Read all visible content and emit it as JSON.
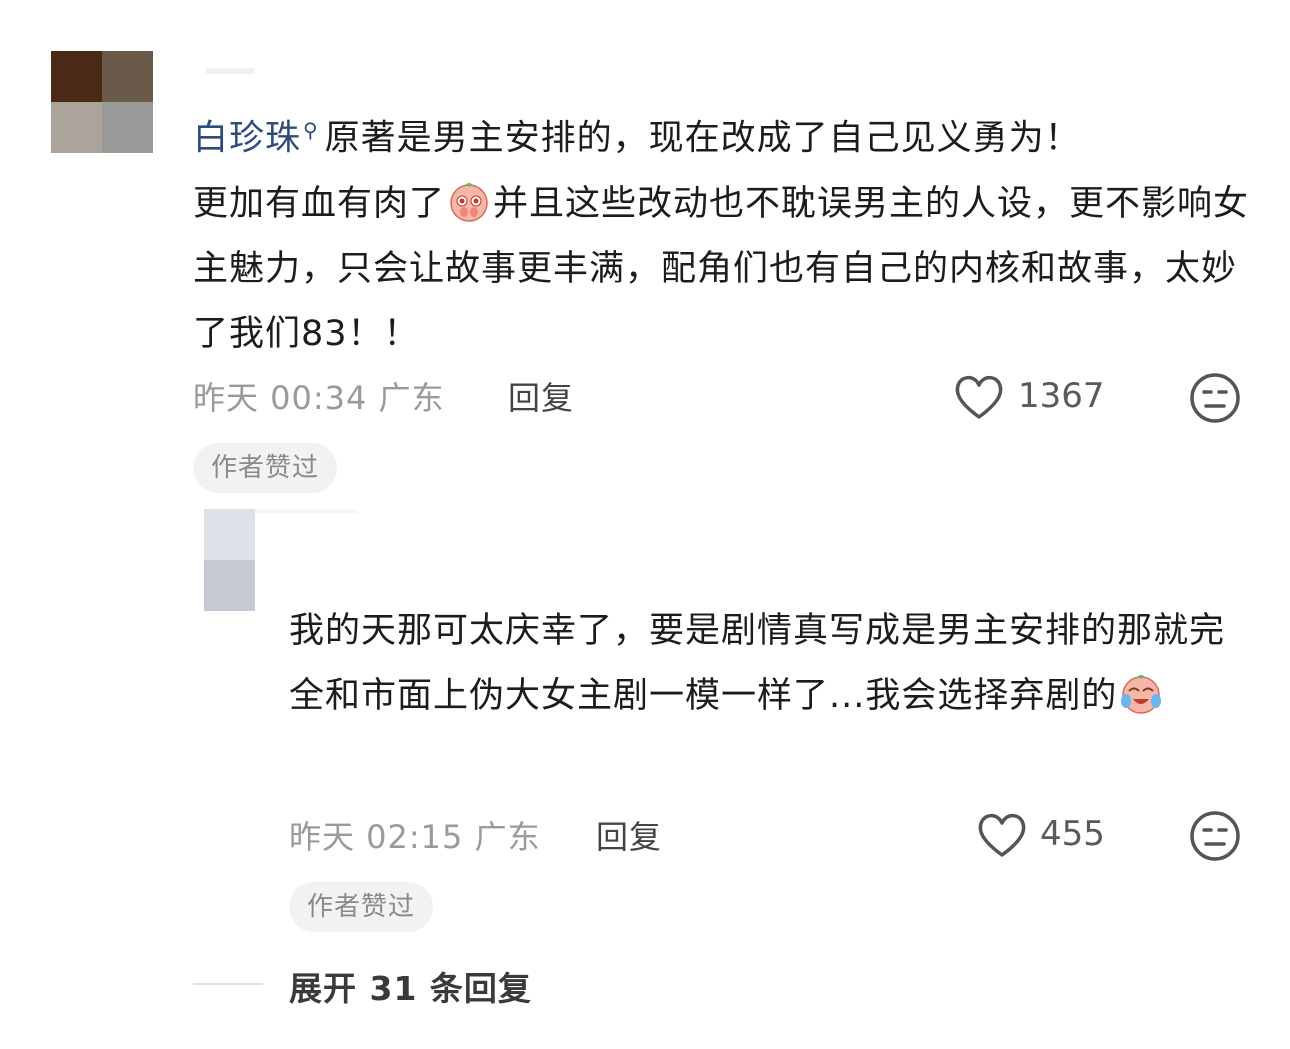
{
  "comment": {
    "author": "白珍珠",
    "text_1": "原著是男主安排的，现在改成了自己见义勇为！",
    "text_2": "更加有血有肉了",
    "text_3": "并且这些改动也不耽误男主的人设，更不影响女主魅力，只会让故事更丰满，配角们也有自己的内核和故事，太妙了我们83！！",
    "emoji_icon": "pleading-peach-emoji-icon",
    "time": "昨天 00:34",
    "location": "广东",
    "reply_label": "回复",
    "likes": "1367",
    "badge": "作者赞过"
  },
  "reply": {
    "text_1": "我的天那可太庆幸了，要是剧情真写成是男主安排的那就完全和市面上伪大女主剧一模一样了...我会选择弃剧的",
    "emoji_icon": "crying-laughing-peach-emoji-icon",
    "time": "昨天 02:15",
    "location": "广东",
    "reply_label": "回复",
    "likes": "455",
    "badge": "作者赞过"
  },
  "expand_label": "展开 31 条回复",
  "colors": {
    "author_link": "#2f4b7c",
    "meta_gray": "#9a9a9a",
    "badge_bg": "#f2f2f2"
  }
}
